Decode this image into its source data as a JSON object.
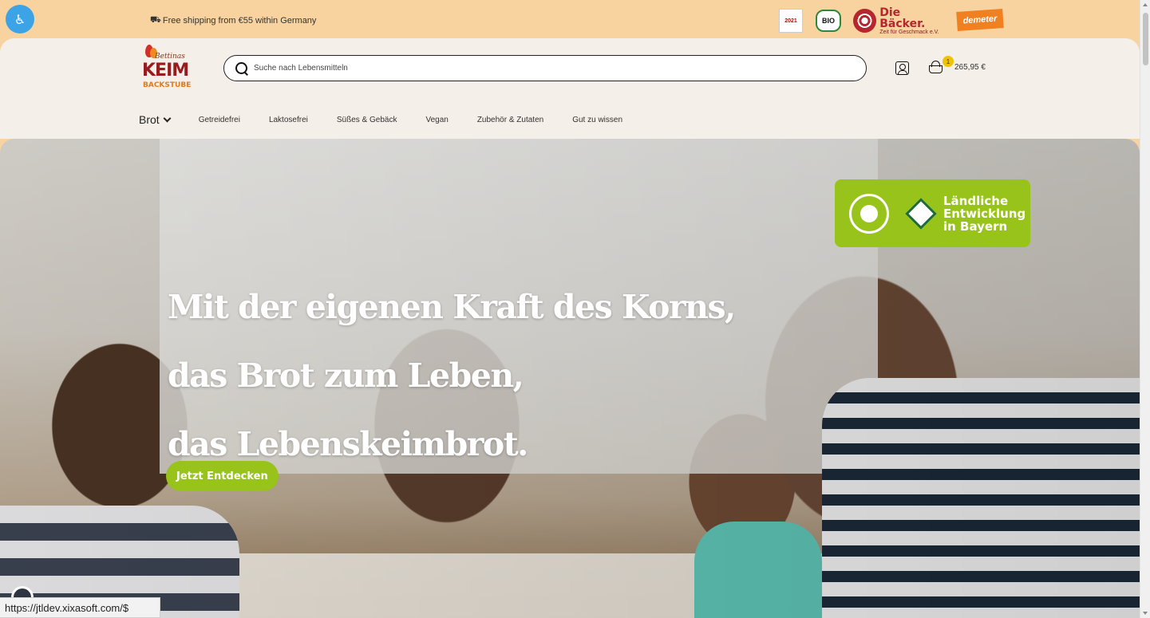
{
  "topbar": {
    "shipping_text": "Free shipping from €55 within Germany",
    "badge_2021": "2021",
    "badge_bio": "BIO",
    "badge_baecker_title": "Die Bäcker.",
    "badge_baecker_sub": "Zeit für Geschmack e.V.",
    "badge_demeter": "demeter"
  },
  "header": {
    "logo_small": "Bettinas",
    "logo_main": "KEIM",
    "logo_sub": "BACKSTUBE",
    "search_placeholder": "Suche nach Lebensmitteln",
    "cart_count": "1",
    "cart_total": "265,95 €"
  },
  "nav": {
    "main": "Brot",
    "items": [
      "Getreidefrei",
      "Laktosefrei",
      "Süßes & Gebäck",
      "Vegan",
      "Zubehör & Zutaten",
      "Gut zu wissen"
    ]
  },
  "hero": {
    "headline_1": "Mit der eigenen Kraft des Korns,",
    "headline_2": "das Brot zum Leben,",
    "headline_3": "das Lebenskeimbrot.",
    "cta_label": "Jetzt Entdecken",
    "badge_text_1": "Ländliche",
    "badge_text_2": "Entwicklung",
    "badge_text_3": "in Bayern"
  },
  "status": {
    "url": "https://jtldev.xixasoft.com/$"
  },
  "colors": {
    "topbar_bg": "#f8d39f",
    "header_bg": "#f4efe9",
    "accent_green": "#97c31b",
    "brand_red": "#9a1b1e",
    "a11y_blue": "#3ba3e6"
  }
}
